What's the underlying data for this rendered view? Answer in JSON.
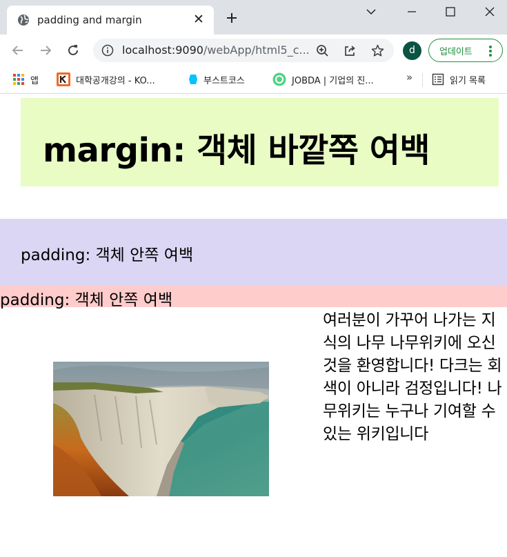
{
  "browser": {
    "tab": {
      "title": "padding and margin",
      "icon": "globe-icon",
      "close_glyph": "✕"
    },
    "toolbar": {
      "url_host": "localhost:9090",
      "url_path": "/webApp/html5_c...",
      "profile_initial": "d",
      "update_label": "업데이트"
    },
    "bookmarks": [
      {
        "label": "앱",
        "icon": "apps-grid-icon"
      },
      {
        "label": "대학공개강의 - KO...",
        "icon": "k-logo-icon"
      },
      {
        "label": "부스트코스",
        "icon": "boostcourse-icon"
      },
      {
        "label": "JOBDA | 기업의 진...",
        "icon": "jobda-icon"
      }
    ],
    "bookmarks_more": "»",
    "reading_list_label": "읽기 목록",
    "colors": {
      "tabbar_bg": "#dee1e6",
      "update_green": "#1e8e3e",
      "avatar_bg": "#0b5342"
    }
  },
  "page": {
    "margin_heading": "margin: 객체 바깥쪽 여백",
    "padding_box_text": "padding: 객체 안쪽 여백",
    "padding_bar_text": "padding: 객체 안쪽 여백",
    "paragraph": "여러분이 가꾸어 나가는 지식의 나무 나무위키에 오신 것을 환영합니다! 다크는 회색이 아니라 검정입니다! 나무위키는 누구나 기여할 수 있는 위키입니다",
    "colors": {
      "margin_box_bg": "#e8fcc4",
      "padding_box_bg": "#dad6f3",
      "padding_bar_bg": "#ffcccc"
    }
  }
}
